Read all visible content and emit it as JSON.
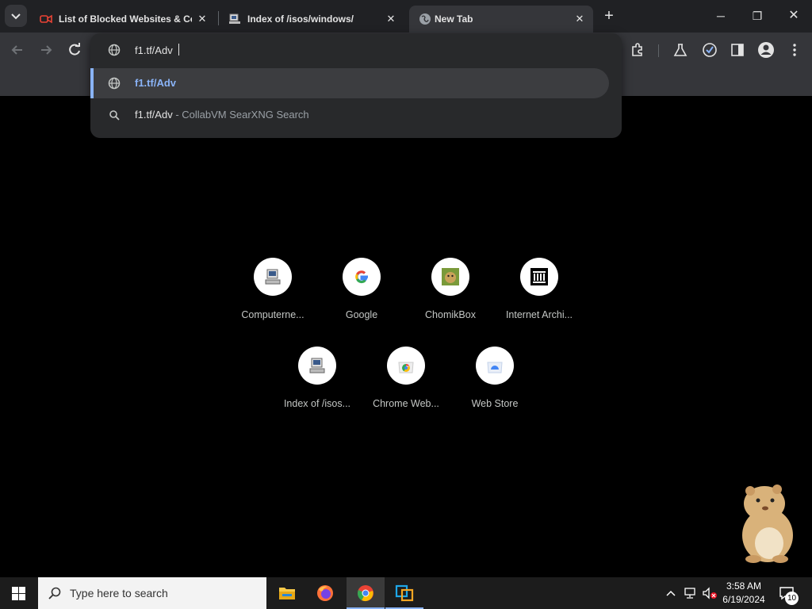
{
  "tabs": [
    {
      "title": "List of Blocked Websites & Con",
      "icon": "video-camera-icon"
    },
    {
      "title": "Index of /isos/windows/",
      "icon": "computer-monitor-icon"
    },
    {
      "title": "New Tab",
      "icon": "globe-icon"
    }
  ],
  "new_tab_symbol": "+",
  "window_controls": {
    "minimize": "─",
    "maximize": "❐",
    "close": "✕"
  },
  "omnibox": {
    "input_value": "f1.tf/Adv",
    "suggestions": [
      {
        "text": "f1.tf/Adv",
        "suffix": "",
        "icon": "globe-icon",
        "selected": true
      },
      {
        "text": "f1.tf/Adv",
        "suffix": " - CollabVM SearXNG Search",
        "icon": "search-icon",
        "selected": false
      }
    ]
  },
  "shortcuts": [
    {
      "label": "Computerne...",
      "icon": "computer-monitor-icon"
    },
    {
      "label": "Google",
      "icon": "google-icon"
    },
    {
      "label": "ChomikBox",
      "icon": "chomikbox-icon"
    },
    {
      "label": "Internet Archi...",
      "icon": "archive-building-icon"
    },
    {
      "label": "Index of /isos...",
      "icon": "computer-monitor-icon"
    },
    {
      "label": "Chrome Web...",
      "icon": "chrome-web-store-icon"
    },
    {
      "label": "Web Store",
      "icon": "web-store-icon"
    }
  ],
  "taskbar": {
    "search_placeholder": "Type here to search",
    "time": "3:58 AM",
    "date": "6/19/2024",
    "notification_count": "10"
  },
  "colors": {
    "tabstrip": "#202124",
    "toolbar": "#35363a",
    "accent_blue": "#8ab4f8",
    "selected_row": "#3c3d40"
  }
}
